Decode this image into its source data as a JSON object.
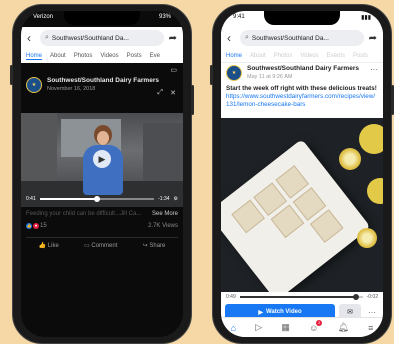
{
  "left": {
    "status": {
      "carrier": "Verizon",
      "time": "",
      "battery": "93%"
    },
    "search": {
      "text": "Southwest/Southland Da..."
    },
    "tabs": [
      {
        "label": "Home",
        "active": true
      },
      {
        "label": "About"
      },
      {
        "label": "Photos"
      },
      {
        "label": "Videos"
      },
      {
        "label": "Posts"
      },
      {
        "label": "Eve"
      }
    ],
    "post": {
      "page_name": "Southwest/Southland Dairy Farmers",
      "date": "November 16, 2018",
      "video": {
        "elapsed": "0:41",
        "remaining": "-1:34",
        "progress": 0.5
      },
      "caption": "Feeding your child can be difficult...Jill Ca...",
      "see_more": "See More",
      "reaction_count": "15",
      "views": "2.7K Views",
      "actions": {
        "like": "Like",
        "comment": "Comment",
        "share": "Share"
      }
    }
  },
  "right": {
    "status": {
      "time": "9:41",
      "battery": ""
    },
    "search": {
      "text": "Southwest/Southland Da..."
    },
    "tabs": [
      {
        "label": "Home",
        "active": true
      },
      {
        "label": "About"
      },
      {
        "label": "Photos"
      },
      {
        "label": "Videos"
      },
      {
        "label": "Events"
      },
      {
        "label": "Posts"
      }
    ],
    "post": {
      "page_name": "Southwest/Southland Dairy Farmers",
      "date": "May 11 at 9:26 AM",
      "text": "Start the week off right with these delicious treats!",
      "link": "https://www.southwestdairyfarmers.com/recipes/view/131/lemon-cheesecake-bars",
      "video": {
        "elapsed": "0:49",
        "remaining": "-0:02",
        "progress": 0.95
      },
      "watch_label": "Watch Video"
    },
    "nav_badge": "2"
  }
}
